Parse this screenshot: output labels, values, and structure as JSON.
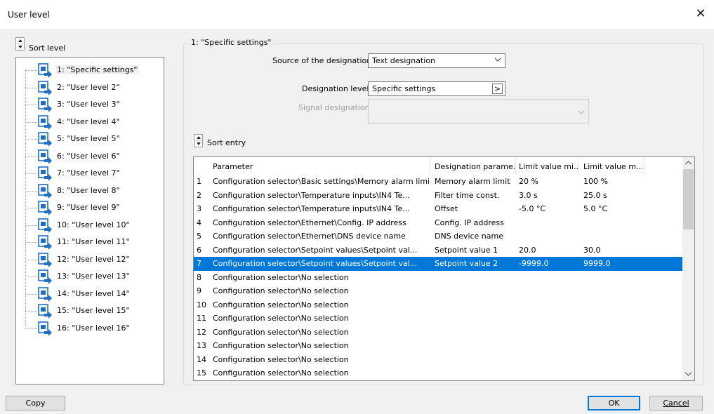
{
  "window": {
    "title": "User level",
    "close_label": "✕"
  },
  "sort_level": {
    "label": "Sort level"
  },
  "tree": {
    "items": [
      {
        "label": "1: \"Specific settings\"",
        "selected": true
      },
      {
        "label": "2: \"User level 2\""
      },
      {
        "label": "3: \"User level 3\""
      },
      {
        "label": "4: \"User level 4\""
      },
      {
        "label": "5: \"User level 5\""
      },
      {
        "label": "6: \"User level 6\""
      },
      {
        "label": "7: \"User level 7\""
      },
      {
        "label": "8: \"User level 8\""
      },
      {
        "label": "9: \"User level 9\""
      },
      {
        "label": "10: \"User level 10\""
      },
      {
        "label": "11: \"User level 11\""
      },
      {
        "label": "12: \"User level 12\""
      },
      {
        "label": "13: \"User level 13\""
      },
      {
        "label": "14: \"User level 14\""
      },
      {
        "label": "15: \"User level 15\""
      },
      {
        "label": "16: \"User level 16\""
      }
    ]
  },
  "group": {
    "title": "1: \"Specific settings\""
  },
  "source": {
    "label": "Source of the designation:",
    "value": "Text designation"
  },
  "designation_level": {
    "label": "Designation level:",
    "value": "Specific settings",
    "button": ">"
  },
  "signal_designation": {
    "label": "Signal designation:",
    "value": ""
  },
  "sort_entry": {
    "label": "Sort entry"
  },
  "table": {
    "headers": [
      "Parameter",
      "Designation parame...",
      "Limit value mi...",
      "Limit value m..."
    ],
    "rows": [
      {
        "n": "1",
        "param": "Configuration selector\\Basic settings\\Memory alarm limit",
        "desig": "Memory alarm limit",
        "min": "20 %",
        "max": "100 %"
      },
      {
        "n": "2",
        "param": "Configuration selector\\Temperature inputs\\IN4 Te...",
        "desig": "Filter time const.",
        "min": "3.0 s",
        "max": "25.0 s"
      },
      {
        "n": "3",
        "param": "Configuration selector\\Temperature inputs\\IN4 Te...",
        "desig": "Offset",
        "min": "-5.0 °C",
        "max": "5.0 °C"
      },
      {
        "n": "4",
        "param": "Configuration selector\\Ethernet\\Config. IP address",
        "desig": "Config. IP address",
        "min": "",
        "max": ""
      },
      {
        "n": "5",
        "param": "Configuration selector\\Ethernet\\DNS device name",
        "desig": "DNS device name",
        "min": "",
        "max": ""
      },
      {
        "n": "6",
        "param": "Configuration selector\\Setpoint values\\Setpoint val...",
        "desig": "Setpoint value 1",
        "min": "20.0",
        "max": "30.0"
      },
      {
        "n": "7",
        "param": "Configuration selector\\Setpoint values\\Setpoint val...",
        "desig": "Setpoint value 2",
        "min": "-9999.0",
        "max": "9999.0",
        "selected": true
      },
      {
        "n": "8",
        "param": "Configuration selector\\No selection",
        "desig": "",
        "min": "",
        "max": ""
      },
      {
        "n": "9",
        "param": "Configuration selector\\No selection",
        "desig": "",
        "min": "",
        "max": ""
      },
      {
        "n": "10",
        "param": "Configuration selector\\No selection",
        "desig": "",
        "min": "",
        "max": ""
      },
      {
        "n": "11",
        "param": "Configuration selector\\No selection",
        "desig": "",
        "min": "",
        "max": ""
      },
      {
        "n": "12",
        "param": "Configuration selector\\No selection",
        "desig": "",
        "min": "",
        "max": ""
      },
      {
        "n": "13",
        "param": "Configuration selector\\No selection",
        "desig": "",
        "min": "",
        "max": ""
      },
      {
        "n": "14",
        "param": "Configuration selector\\No selection",
        "desig": "",
        "min": "",
        "max": ""
      },
      {
        "n": "15",
        "param": "Configuration selector\\No selection",
        "desig": "",
        "min": "",
        "max": ""
      }
    ]
  },
  "buttons": {
    "copy": "Copy",
    "ok": "OK",
    "cancel": "Cancel"
  },
  "colors": {
    "selection": "#0078d7",
    "background": "#f0f0f0",
    "icon_blue": "#1f6fc5"
  }
}
